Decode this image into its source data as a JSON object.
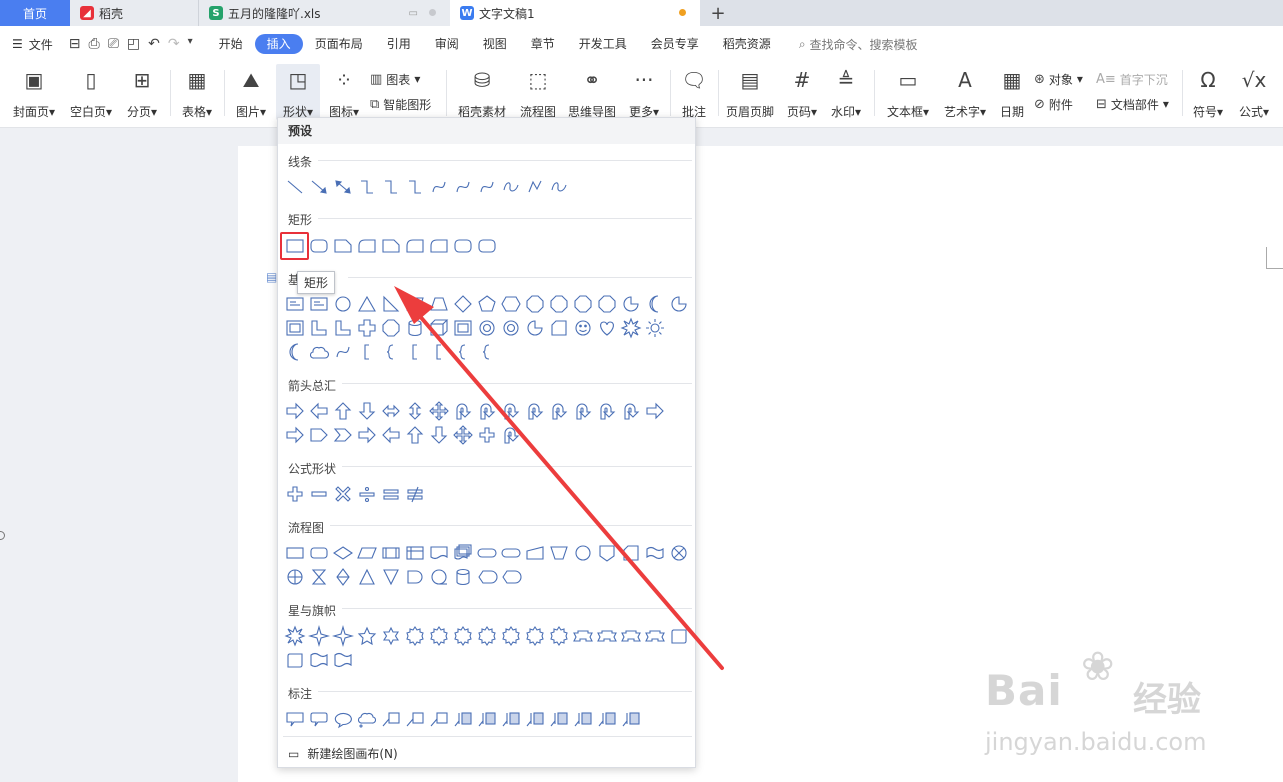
{
  "tabs": [
    {
      "label": "首页"
    },
    {
      "label": "稻壳"
    },
    {
      "label": "五月的隆隆吖.xls"
    },
    {
      "label": "文字文稿1"
    }
  ],
  "menu": {
    "file": "文件",
    "items": [
      "开始",
      "插入",
      "页面布局",
      "引用",
      "审阅",
      "视图",
      "章节",
      "开发工具",
      "会员专享",
      "稻壳资源"
    ],
    "search_placeholder": "查找命令、搜索模板"
  },
  "ribbon": {
    "cover": "封面页",
    "blank": "空白页",
    "pagebreak": "分页",
    "table": "表格",
    "picture": "图片",
    "shape": "形状",
    "icon": "图标",
    "chart": "图表",
    "smartart": "智能图形",
    "docer": "稻壳素材",
    "flowchart": "流程图",
    "mindmap": "思维导图",
    "more": "更多",
    "comment": "批注",
    "headerfooter": "页眉页脚",
    "pagenum": "页码",
    "watermark": "水印",
    "textbox": "文本框",
    "wordart": "艺术字",
    "date": "日期",
    "object": "对象",
    "dropcap": "首字下沉",
    "attachment": "附件",
    "docpart": "文档部件",
    "symbol": "符号",
    "formula": "公式"
  },
  "dropdown": {
    "header": "预设",
    "sections": {
      "lines": "线条",
      "rect": "矩形",
      "basic": "基",
      "arrows": "箭头总汇",
      "formula": "公式形状",
      "flow": "流程图",
      "stars": "星与旗帜",
      "callout": "标注"
    },
    "tooltip": "矩形",
    "footer": "新建绘图画布(N)"
  },
  "watermark": {
    "brand": "Bai",
    "brand_cn": "经验",
    "url": "jingyan.baidu.com"
  },
  "colors": {
    "accent": "#4a7ef0",
    "highlight": "#e8313a",
    "shape_stroke": "#4a6fb5"
  }
}
